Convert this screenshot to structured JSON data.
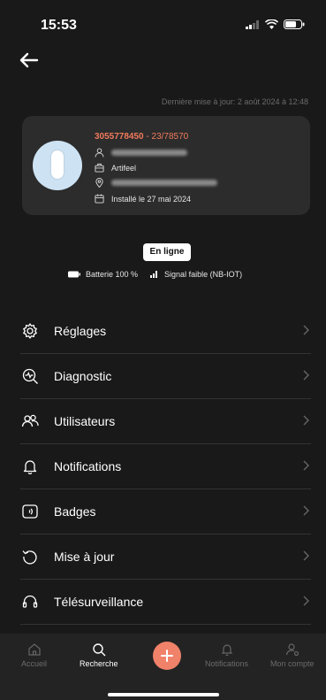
{
  "status_bar": {
    "time": "15:53"
  },
  "header": {
    "last_update": "Dernière mise à jour: 2 août 2024 à 12:48"
  },
  "device_card": {
    "serial": "3055778450",
    "serial_suffix": " - 23/78570",
    "company": "Artifeel",
    "installed": "Installé le 27 mai 2024"
  },
  "status": {
    "online_label": "En ligne",
    "battery_label": "Batterie 100 %",
    "signal_label": "Signal faible (NB-IOT)"
  },
  "menu": {
    "items": [
      {
        "label": "Réglages",
        "icon": "gear-icon"
      },
      {
        "label": "Diagnostic",
        "icon": "diagnostic-icon"
      },
      {
        "label": "Utilisateurs",
        "icon": "users-icon"
      },
      {
        "label": "Notifications",
        "icon": "bell-icon"
      },
      {
        "label": "Badges",
        "icon": "badge-icon"
      },
      {
        "label": "Mise à jour",
        "icon": "refresh-icon"
      },
      {
        "label": "Télésurveillance",
        "icon": "headset-icon"
      }
    ]
  },
  "tabbar": {
    "home": "Accueil",
    "search": "Recherche",
    "notifications": "Notifications",
    "account": "Mon compte"
  },
  "colors": {
    "accent": "#f07a5c",
    "background": "#191919",
    "card": "#2c2c2c"
  }
}
